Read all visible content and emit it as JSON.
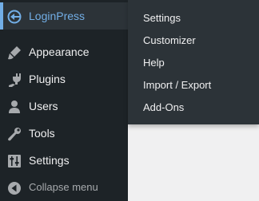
{
  "sidebar": {
    "items": [
      {
        "label": "LoginPress",
        "icon": "loginpress-icon",
        "active": true
      },
      {
        "label": "Appearance",
        "icon": "paintbrush-icon"
      },
      {
        "label": "Plugins",
        "icon": "plugin-icon"
      },
      {
        "label": "Users",
        "icon": "users-icon"
      },
      {
        "label": "Tools",
        "icon": "wrench-icon"
      },
      {
        "label": "Settings",
        "icon": "settings-sliders-icon"
      }
    ],
    "collapse": {
      "label": "Collapse menu",
      "icon": "collapse-arrow-icon"
    }
  },
  "flyout": {
    "items": [
      {
        "label": "Settings"
      },
      {
        "label": "Customizer"
      },
      {
        "label": "Help"
      },
      {
        "label": "Import / Export"
      },
      {
        "label": "Add-Ons"
      }
    ]
  },
  "colors": {
    "sidebar_bg": "#1d2327",
    "flyout_bg": "#2c3338",
    "accent": "#72aee6",
    "text": "#f0f0f1",
    "muted": "#a7aaad",
    "content_bg": "#f0f0f1"
  }
}
